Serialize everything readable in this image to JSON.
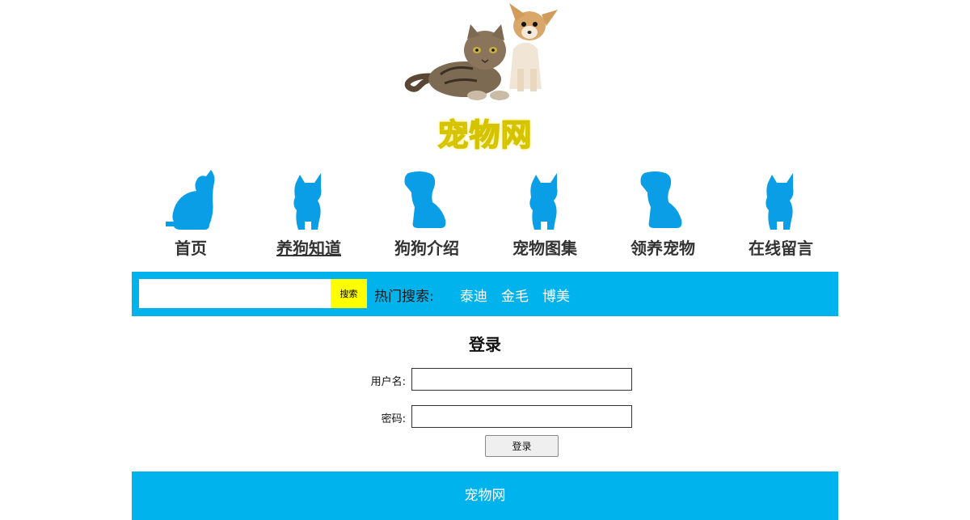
{
  "header": {
    "site_title": "宠物网"
  },
  "nav": {
    "items": [
      {
        "label": "首页",
        "icon": "sitting-cat-silhouette-icon",
        "active": false
      },
      {
        "label": "养狗知道",
        "icon": "kitten-silhouette-icon",
        "active": true
      },
      {
        "label": "狗狗介绍",
        "icon": "puppy-silhouette-icon",
        "active": false
      },
      {
        "label": "宠物图集",
        "icon": "kitten-silhouette-icon",
        "active": false
      },
      {
        "label": "领养宠物",
        "icon": "puppy-silhouette-icon",
        "active": false
      },
      {
        "label": "在线留言",
        "icon": "kitten-silhouette-icon",
        "active": false
      }
    ],
    "icon_color": "#0a9ee6"
  },
  "search": {
    "input_value": "",
    "button_label": "搜索",
    "hot_label": "热门搜索:",
    "hot_links": [
      "泰迪",
      "金毛",
      "博美"
    ],
    "bar_color": "#00b3ec",
    "button_color": "#ffff00"
  },
  "login": {
    "title": "登录",
    "username_label": "用户名:",
    "username_value": "",
    "password_label": "密码:",
    "password_value": "",
    "submit_label": "登录"
  },
  "footer": {
    "text": "宠物网"
  }
}
